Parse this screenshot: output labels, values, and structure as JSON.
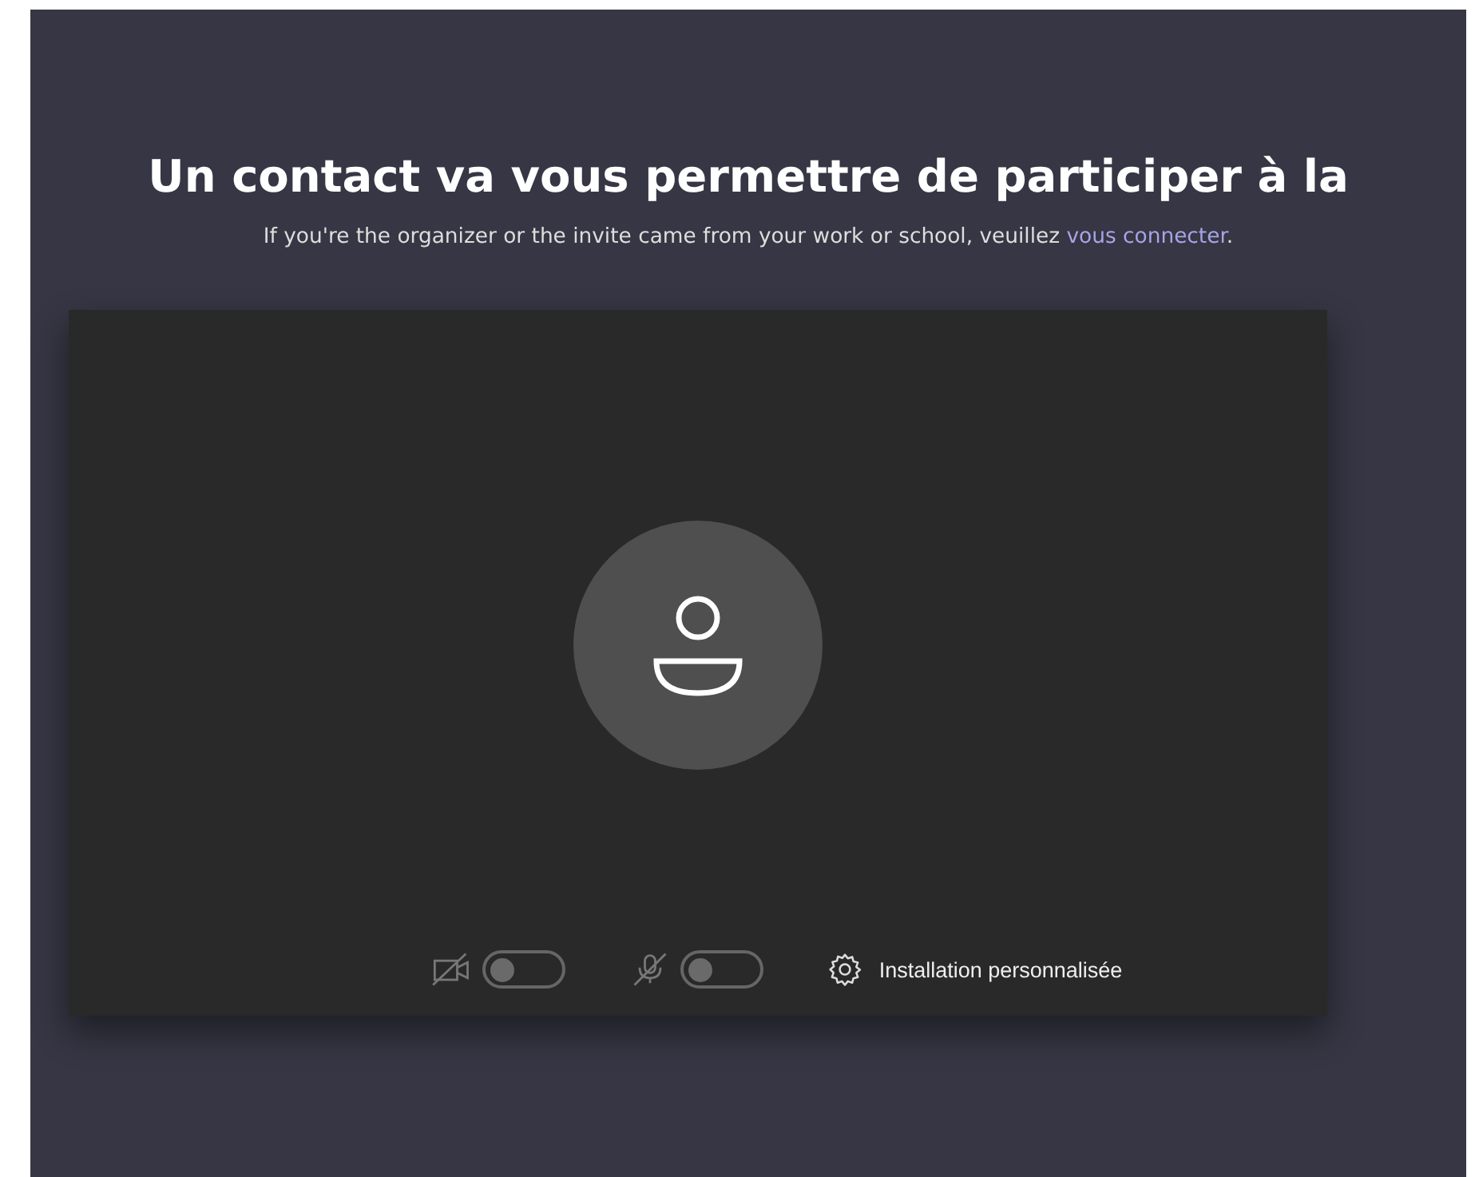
{
  "title": "Un contact va vous permettre de participer à la",
  "subtitle": {
    "text": "If you're the organizer or the invite came from your work or school, veuillez ",
    "link": "vous connecter",
    "end": "."
  },
  "controls": [
    {
      "kind": "camera",
      "on": false
    },
    {
      "kind": "microphone",
      "on": false
    }
  ],
  "settings": {
    "label": "Installation personnalisée"
  }
}
